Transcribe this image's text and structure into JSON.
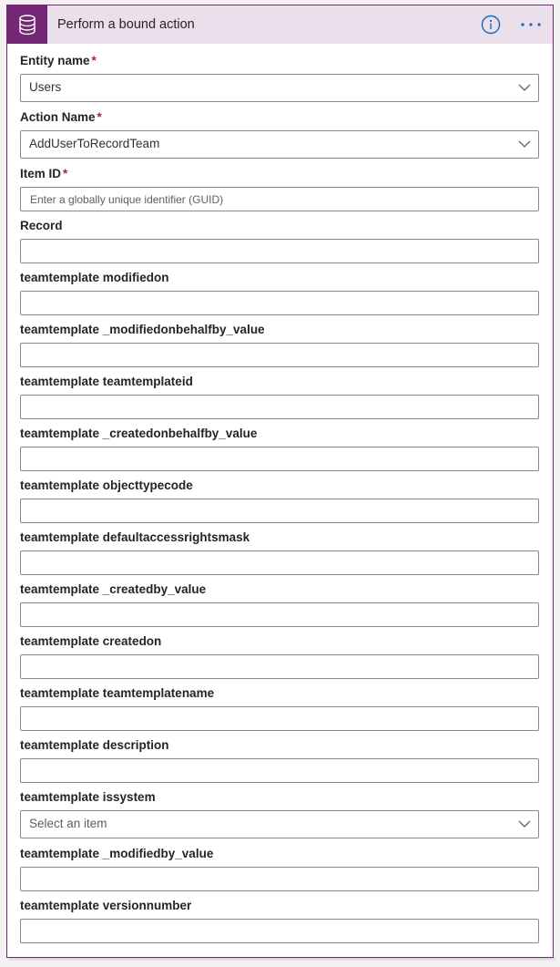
{
  "header": {
    "title": "Perform a bound action",
    "app_icon": "database-icon",
    "info_icon": "info-icon",
    "more_icon": "more-options-icon",
    "accent_color": "#742774",
    "header_bg": "#ebdfeb"
  },
  "fields": {
    "entity_name": {
      "label": "Entity name",
      "required_mark": "*",
      "value": "Users"
    },
    "action_name": {
      "label": "Action Name",
      "required_mark": "*",
      "value": "AddUserToRecordTeam"
    },
    "item_id": {
      "label": "Item ID",
      "required_mark": "*",
      "placeholder": "Enter a globally unique identifier (GUID)"
    },
    "record": {
      "label": "Record"
    },
    "modifiedon": {
      "label": "teamtemplate modifiedon"
    },
    "modifiedonbehalfby_value": {
      "label": "teamtemplate _modifiedonbehalfby_value"
    },
    "teamtemplateid": {
      "label": "teamtemplate teamtemplateid"
    },
    "createdonbehalfby_value": {
      "label": "teamtemplate _createdonbehalfby_value"
    },
    "objecttypecode": {
      "label": "teamtemplate objecttypecode"
    },
    "defaultaccessrightsmask": {
      "label": "teamtemplate defaultaccessrightsmask"
    },
    "createdby_value": {
      "label": "teamtemplate _createdby_value"
    },
    "createdon": {
      "label": "teamtemplate createdon"
    },
    "teamtemplatename": {
      "label": "teamtemplate teamtemplatename"
    },
    "description": {
      "label": "teamtemplate description"
    },
    "issystem": {
      "label": "teamtemplate issystem",
      "placeholder": "Select an item"
    },
    "modifiedby_value": {
      "label": "teamtemplate _modifiedby_value"
    },
    "versionnumber": {
      "label": "teamtemplate versionnumber"
    }
  }
}
